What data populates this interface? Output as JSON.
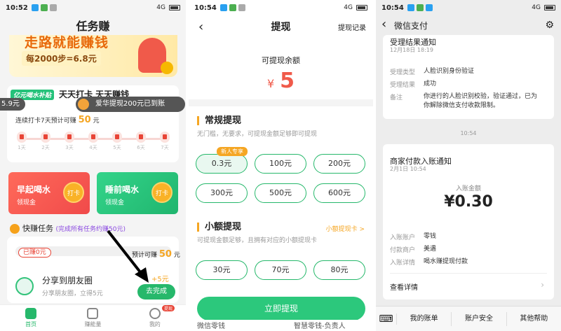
{
  "panel1": {
    "time": "10:52",
    "network": "4G",
    "title": "任务赚",
    "banner": {
      "line1": "走路就能赚钱",
      "line2": "每2000步=6.8元"
    },
    "daily": {
      "tag": "亿元喝水补贴",
      "title": "天天打卡 天天赚钱",
      "pill": "5.9元"
    },
    "toast": "爱华提现200元已到账",
    "streak": {
      "text": "连续打卡7天预计可赚",
      "amount": "50",
      "unit": "元"
    },
    "days": [
      "1天",
      "2天",
      "3天",
      "4天",
      "5天",
      "6天",
      "7天"
    ],
    "drink_morning": {
      "title": "早起喝水",
      "sub": "领现金",
      "btn": "打卡"
    },
    "drink_night": {
      "title": "睡前喝水",
      "sub": "领现金",
      "btn": "打卡"
    },
    "quick": {
      "title": "快赚任务",
      "sub": "(完成所有任务约赚50元)"
    },
    "earned": "已赚0元",
    "expected": {
      "text": "预计可赚",
      "amount": "50",
      "unit": "元"
    },
    "share": {
      "title": "分享到朋友圈",
      "sub": "分享朋友圈，立得5元",
      "reward": "+5元",
      "button": "去完成"
    },
    "tabs": [
      {
        "label": "首页"
      },
      {
        "label": "赚能量"
      },
      {
        "label": "我的",
        "badge": "提现"
      }
    ]
  },
  "panel2": {
    "time": "10:54",
    "network": "4G",
    "title": "提现",
    "record_link": "提现记录",
    "balance_label": "可提现余额",
    "currency": "¥",
    "balance": "5",
    "regular": {
      "title": "常规提现",
      "desc": "无门槛，无要求，可提现金额足够即可提现"
    },
    "new_tag": "新人专享",
    "regular_amounts": [
      "0.3元",
      "100元",
      "200元",
      "300元",
      "500元",
      "600元"
    ],
    "small": {
      "title": "小额提现",
      "link": "小额提现卡 >",
      "desc": "可提现金额足够，且拥有对应的小额提现卡"
    },
    "small_amounts": [
      "30元",
      "70元",
      "80元"
    ],
    "withdraw_button": "立即提现",
    "footer": [
      "微信零钱",
      "智慧零钱-负责人"
    ]
  },
  "panel3": {
    "time": "10:54",
    "network": "4G",
    "title": "微信支付",
    "msg1": {
      "title": "受理结果通知",
      "date": "12月18日 18:19",
      "rows": [
        {
          "k": "受理类型",
          "v": "人脸识别身份验证"
        },
        {
          "k": "受理结果",
          "v": "成功"
        },
        {
          "k": "备注",
          "v": "你进行的人脸识别校验，验证通过，已为你解除微信支付收款限制。"
        }
      ]
    },
    "time_sep": "10:54",
    "msg2": {
      "title": "商家付款入账通知",
      "date": "2月1日 10:54",
      "amount_label": "入账金额",
      "amount": "¥0.30",
      "rows": [
        {
          "k": "入账账户",
          "v": "零钱"
        },
        {
          "k": "付款商户",
          "v": "美遇"
        },
        {
          "k": "入账详情",
          "v": "喝水赚提现付款"
        }
      ],
      "detail_link": "查看详情"
    },
    "menus": [
      "我的账单",
      "账户安全",
      "其他帮助"
    ]
  }
}
